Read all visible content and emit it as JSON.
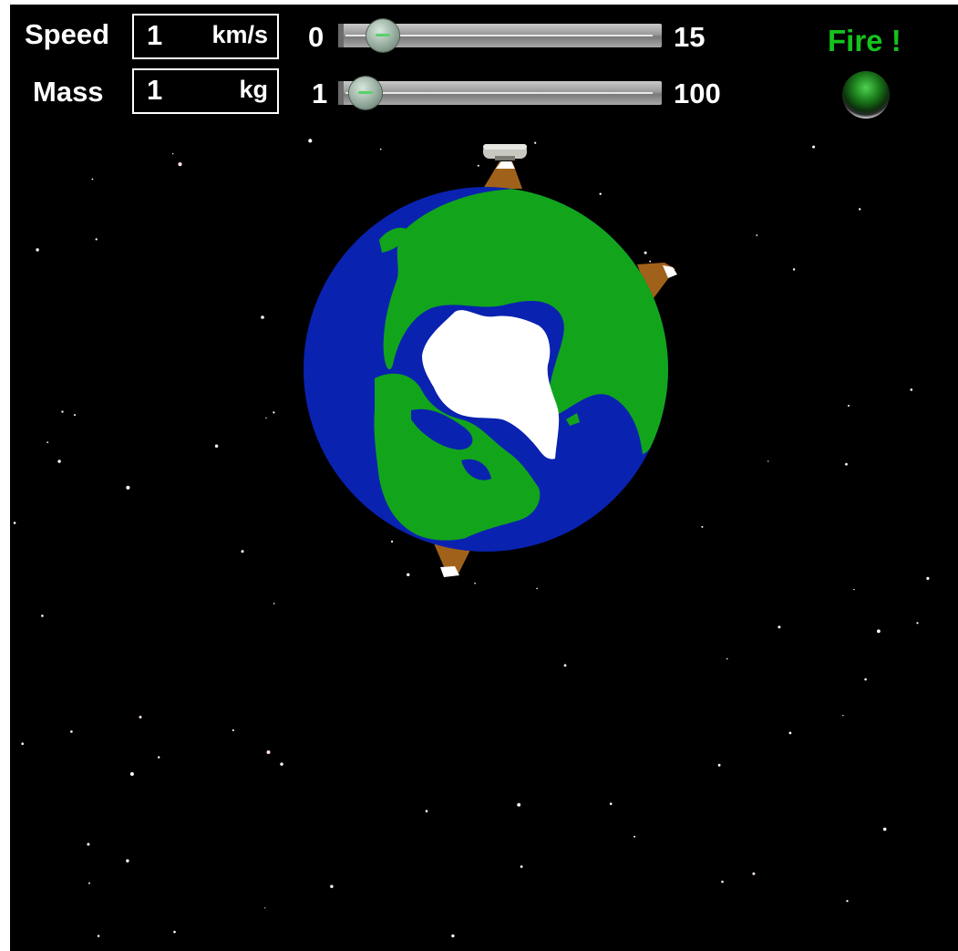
{
  "speed": {
    "label": "Speed",
    "value": "1",
    "unit": "km/s",
    "min_label": "0",
    "max_label": "15",
    "fraction": 0.07
  },
  "mass": {
    "label": "Mass",
    "value": "1",
    "unit": "kg",
    "min_label": "1",
    "max_label": "100",
    "fraction": 0.0
  },
  "fire": {
    "label": "Fire !",
    "color": "#15c21d"
  },
  "colors": {
    "space": "#000000",
    "ocean": "#0a22b0",
    "land": "#12a51c",
    "ice": "#ffffff",
    "mountain": "#a0621a",
    "text": "#ffffff"
  }
}
